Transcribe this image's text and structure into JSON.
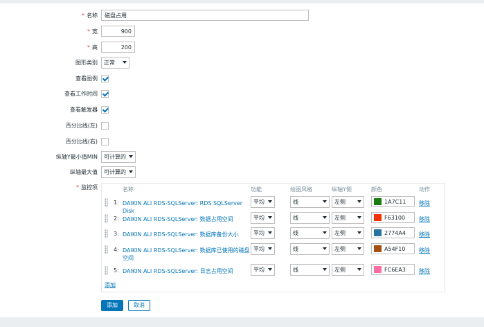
{
  "form": {
    "name": {
      "label": "名称",
      "value": "磁盘占用"
    },
    "width": {
      "label": "宽",
      "value": "900"
    },
    "height": {
      "label": "高",
      "value": "200"
    },
    "graph_type": {
      "label": "图形类别",
      "value": "正常"
    },
    "show_legend": {
      "label": "查看图例",
      "checked": true
    },
    "show_work_period": {
      "label": "查看工作时间",
      "checked": true
    },
    "show_triggers": {
      "label": "查看触发器",
      "checked": true
    },
    "percentile_left": {
      "label": "百分比线(左)",
      "checked": false
    },
    "percentile_right": {
      "label": "百分比线(右)",
      "checked": false
    },
    "y_min": {
      "label": "纵轴Y最小值MIN",
      "value": "可计算的"
    },
    "y_max": {
      "label": "纵轴最大值",
      "value": "可计算的"
    },
    "items_label": "监控项"
  },
  "items": {
    "headers": {
      "name": "名称",
      "function": "功能",
      "draw_style": "绘图风格",
      "y_axis": "纵轴Y侧",
      "color": "颜色",
      "action": "动作"
    },
    "rows": [
      {
        "idx": "1:",
        "name": "DAIKIN ALI RDS-SQLServer: RDS SQLServer Disk",
        "function": "平均",
        "draw_style": "线",
        "y_axis": "左侧",
        "color_hex": "1A7C11",
        "color": "#1A7C11",
        "action": "移除"
      },
      {
        "idx": "2:",
        "name": "DAIKIN ALI RDS-SQLServer: 数据占用空间",
        "function": "平均",
        "draw_style": "线",
        "y_axis": "左侧",
        "color_hex": "F63100",
        "color": "#F63100",
        "action": "移除"
      },
      {
        "idx": "3:",
        "name": "DAIKIN ALI RDS-SQLServer: 数据库备份大小",
        "function": "平均",
        "draw_style": "线",
        "y_axis": "左侧",
        "color_hex": "2774A4",
        "color": "#2774A4",
        "action": "移除"
      },
      {
        "idx": "4:",
        "name": "DAIKIN ALI RDS-SQLServer: 数据库已使用的磁盘空间",
        "function": "平均",
        "draw_style": "线",
        "y_axis": "左侧",
        "color_hex": "A54F10",
        "color": "#A54F10",
        "action": "移除"
      },
      {
        "idx": "5:",
        "name": "DAIKIN ALI RDS-SQLServer: 日志占用空间",
        "function": "平均",
        "draw_style": "线",
        "y_axis": "左侧",
        "color_hex": "FC6EA3",
        "color": "#FC6EA3",
        "action": "移除"
      }
    ],
    "add_link": "添加"
  },
  "buttons": {
    "add": "添加",
    "cancel": "取消"
  },
  "colors": {
    "accent": "#0275b8",
    "required": "#e33734"
  }
}
